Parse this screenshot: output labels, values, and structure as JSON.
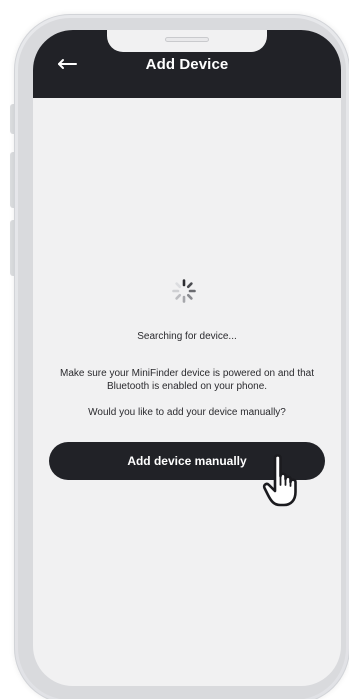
{
  "header": {
    "title": "Add Device",
    "back_icon": "arrow-left-icon"
  },
  "status": {
    "searching_text": "Searching for device...",
    "spinner_icon": "loading-spinner-icon"
  },
  "instructions": {
    "text": "Make sure your MiniFinder device is powered on and that Bluetooth is enabled on your phone.",
    "question": "Would you like to add your device manually?"
  },
  "actions": {
    "add_manually_label": "Add device manually"
  },
  "pointer": {
    "icon": "pointing-hand-cursor-icon"
  },
  "colors": {
    "header_bg": "#212227",
    "screen_bg": "#f1f1f2",
    "button_bg": "#212227",
    "text": "#2a2a2e"
  }
}
